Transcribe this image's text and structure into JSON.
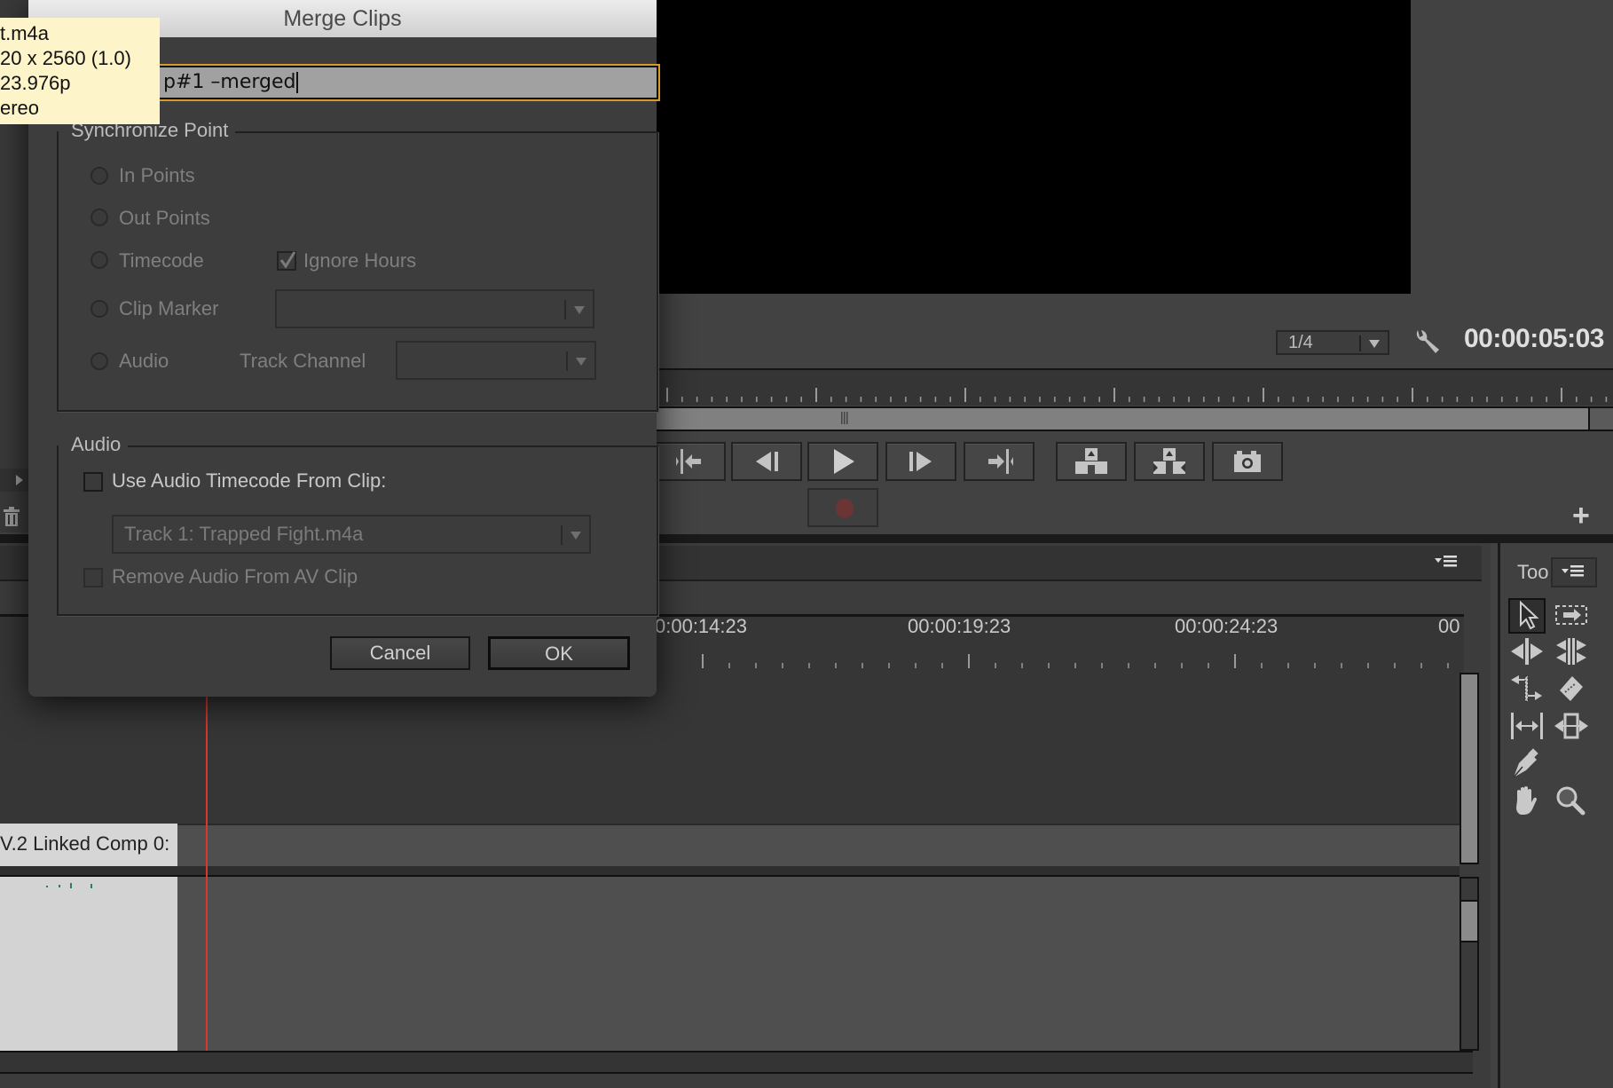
{
  "tooltip": {
    "lines": [
      "t.m4a",
      "20 x 2560 (1.0)",
      "23.976p",
      "ereo"
    ]
  },
  "dialog": {
    "title": "Merge Clips",
    "name_value": "p#1 –merged",
    "sync_group": {
      "title": "Synchronize Point",
      "options": [
        {
          "label": "In Points",
          "selected": false
        },
        {
          "label": "Out Points",
          "selected": false
        },
        {
          "label": "Timecode",
          "selected": false
        },
        {
          "label": "Clip Marker",
          "selected": false
        },
        {
          "label": "Audio",
          "selected": false
        }
      ],
      "ignore_hours_label": "Ignore Hours",
      "ignore_hours_checked": true,
      "clip_marker_value": "",
      "track_channel_label": "Track Channel",
      "track_channel_value": ""
    },
    "audio_group": {
      "title": "Audio",
      "use_audio_timecode_label": "Use Audio Timecode From Clip:",
      "use_audio_timecode_checked": false,
      "track_select_value": "Track 1: Trapped Fight.m4a",
      "remove_audio_label": "Remove Audio From AV Clip",
      "remove_audio_checked": false
    },
    "cancel_label": "Cancel",
    "ok_label": "OK"
  },
  "monitor": {
    "zoom_value": "1/4",
    "timecode": "00:00:05:03",
    "add_button_label": "+"
  },
  "transport_buttons": [
    {
      "name": "go-to-in-point",
      "icon": "go-to-in-icon"
    },
    {
      "name": "step-back",
      "icon": "step-back-icon"
    },
    {
      "name": "play",
      "icon": "play-icon"
    },
    {
      "name": "step-forward",
      "icon": "step-forward-icon"
    },
    {
      "name": "go-to-out-point",
      "icon": "go-to-out-icon"
    },
    {
      "name": "lift",
      "icon": "lift-icon"
    },
    {
      "name": "extract",
      "icon": "extract-icon"
    },
    {
      "name": "export-frame",
      "icon": "camera-icon"
    }
  ],
  "timeline": {
    "ruler_labels": [
      "0:00:14:23",
      "00:00:19:23",
      "00:00:24:23",
      "00"
    ],
    "video_clip_label": "V.2 Linked Comp 0:"
  },
  "tools": {
    "tab_label": "Too",
    "items": [
      "selection-tool",
      "track-select-tool",
      "ripple-edit-tool",
      "rolling-edit-tool",
      "rate-stretch-tool",
      "razor-tool",
      "slip-tool",
      "slide-tool",
      "pen-tool",
      "hand-tool",
      "zoom-tool"
    ]
  }
}
